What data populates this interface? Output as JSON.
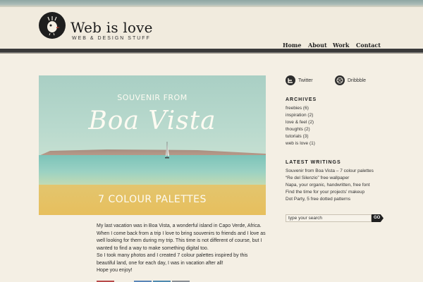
{
  "site": {
    "title": "Web is love",
    "tagline": "WEB & DESIGN STUFF"
  },
  "nav": {
    "items": [
      "Home",
      "About",
      "Work",
      "Contact"
    ]
  },
  "hero": {
    "line1": "SOUVENIR FROM",
    "line2": "Boa Vista",
    "line3": "7 COLOUR PALETTES"
  },
  "post": {
    "paragraphs": [
      "My last vacation was in Boa Vista, a wonderful island in Capo Verde, Africa. When I come back from a trip I love to bring souvenirs to friends and I love as well looking for them during my trip. This time is not different of course, but I wanted to find a way to make something digital too.",
      "So I took many photos and I created 7 colour palettes inspired by this beautiful land, one for each day, I was in vacation after all!",
      "Hope you enjoy!"
    ]
  },
  "social": {
    "twitter": "Twitter",
    "dribbble": "Dribbble"
  },
  "archives": {
    "heading": "ARCHIVES",
    "items": [
      "freebies (6)",
      "inspiration (2)",
      "love & feel (2)",
      "thoughts (2)",
      "tutorials (3)",
      "web is love (1)"
    ]
  },
  "latest": {
    "heading": "LATEST WRITINGS",
    "items": [
      "Souvenir from Boa Vista – 7 colour palettes",
      "“Re del Silenzio” free wallpaper",
      "Napa, your organic, handwritten, free font",
      "Find the time for your projects’ makeup",
      "Dot Party, 5 free dotted patterns"
    ]
  },
  "search": {
    "placeholder": "type your search",
    "button": "GO"
  },
  "colors": {
    "share": [
      "#b84b4b",
      "#5a86b8",
      "#4f8ab0",
      "#8a8f95"
    ]
  }
}
